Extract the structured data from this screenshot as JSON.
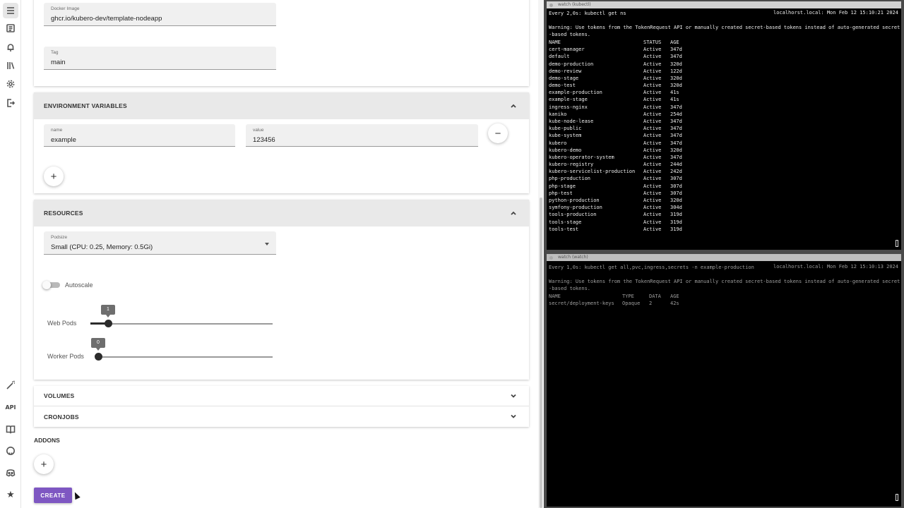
{
  "sidebar": {
    "top_icons": [
      "apps-icon",
      "list-icon",
      "bell-icon",
      "library-icon",
      "gear-icon",
      "logout-icon"
    ],
    "bottom_icons": [
      "wand-icon",
      "api-icon",
      "book-icon",
      "github-icon",
      "discord-icon",
      "star-icon"
    ],
    "api_label": "API"
  },
  "form": {
    "docker_image": {
      "label": "Docker Image",
      "value": "ghcr.io/kubero-dev/template-nodeapp"
    },
    "tag": {
      "label": "Tag",
      "value": "main"
    },
    "env_section": {
      "title": "ENVIRONMENT VARIABLES",
      "name_label": "name",
      "name_value": "example",
      "value_label": "value",
      "value_value": "123456",
      "remove_symbol": "−",
      "add_symbol": "+"
    },
    "resources_section": {
      "title": "RESOURCES",
      "podsize_label": "Podsize",
      "podsize_value": "Small (CPU: 0.25, Memory: 0.5Gi)",
      "autoscale_label": "Autoscale",
      "autoscale_on": false,
      "web_pods_label": "Web Pods",
      "web_pods_value": "1",
      "worker_pods_label": "Worker Pods",
      "worker_pods_value": "0"
    },
    "volumes_title": "VOLUMES",
    "cronjobs_title": "CRONJOBS",
    "addons_title": "ADDONS",
    "add_addon_symbol": "+",
    "create_label": "CREATE"
  },
  "colors": {
    "accent": "#7e57c2",
    "panel_header": "#e9e9e9",
    "terminal_bg": "#000000"
  },
  "terminal_top": {
    "title": "watch (kubectl)",
    "command": "Every 2,0s: kubectl get ns",
    "host_time": "localhorst.local: Mon Feb 12 15:10:21 2024",
    "warning_1": "Warning: Use tokens from the TokenRequest API or manually created secret-based tokens instead of auto-generated secret",
    "warning_2": "-based tokens.",
    "headers": [
      "NAME",
      "STATUS",
      "AGE"
    ],
    "rows": [
      [
        "cert-manager",
        "Active",
        "347d"
      ],
      [
        "default",
        "Active",
        "347d"
      ],
      [
        "demo-production",
        "Active",
        "320d"
      ],
      [
        "demo-review",
        "Active",
        "122d"
      ],
      [
        "demo-stage",
        "Active",
        "320d"
      ],
      [
        "demo-test",
        "Active",
        "320d"
      ],
      [
        "example-production",
        "Active",
        "41s"
      ],
      [
        "example-stage",
        "Active",
        "41s"
      ],
      [
        "ingress-nginx",
        "Active",
        "347d"
      ],
      [
        "kaniko",
        "Active",
        "254d"
      ],
      [
        "kube-node-lease",
        "Active",
        "347d"
      ],
      [
        "kube-public",
        "Active",
        "347d"
      ],
      [
        "kube-system",
        "Active",
        "347d"
      ],
      [
        "kubero",
        "Active",
        "347d"
      ],
      [
        "kubero-demo",
        "Active",
        "320d"
      ],
      [
        "kubero-operator-system",
        "Active",
        "347d"
      ],
      [
        "kubero-registry",
        "Active",
        "244d"
      ],
      [
        "kubero-servicelist-production",
        "Active",
        "242d"
      ],
      [
        "php-production",
        "Active",
        "307d"
      ],
      [
        "php-stage",
        "Active",
        "307d"
      ],
      [
        "php-test",
        "Active",
        "307d"
      ],
      [
        "python-production",
        "Active",
        "320d"
      ],
      [
        "symfony-production",
        "Active",
        "304d"
      ],
      [
        "tools-production",
        "Active",
        "319d"
      ],
      [
        "tools-stage",
        "Active",
        "319d"
      ],
      [
        "tools-test",
        "Active",
        "319d"
      ]
    ]
  },
  "terminal_bottom": {
    "title": "watch (watch)",
    "command": "Every 1,0s: kubectl get all,pvc,ingress,secrets -n example-production",
    "host_time": "localhorst.local: Mon Feb 12 15:10:13 2024",
    "warning_1": "Warning: Use tokens from the TokenRequest API or manually created secret-based tokens instead of auto-generated secret",
    "warning_2": "-based tokens.",
    "headers": [
      "NAME",
      "TYPE",
      "DATA",
      "AGE"
    ],
    "rows": [
      [
        "secret/deployment-keys",
        "Opaque",
        "2",
        "42s"
      ]
    ]
  }
}
